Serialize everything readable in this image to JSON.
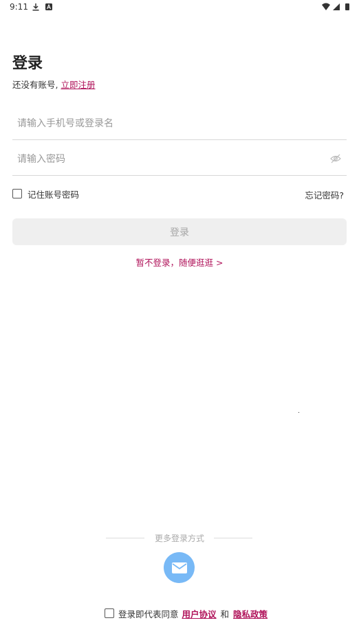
{
  "status_bar": {
    "time": "9:11",
    "download_icon": "download-icon",
    "app_icon": "a-box-icon",
    "signal_icons": [
      "wifi-icon",
      "cell-signal-icon",
      "battery-icon"
    ]
  },
  "header": {
    "title": "登录",
    "no_account_text": "还没有账号,",
    "register_link": "立即注册"
  },
  "form": {
    "username_placeholder": "请输入手机号或登录名",
    "username_value": "",
    "password_placeholder": "请输入密码",
    "password_value": "",
    "remember_label": "记住账号密码",
    "remember_checked": false,
    "forgot_link": "忘记密码?",
    "login_button": "登录",
    "guest_link": "暂不登录，随便逛逛 >"
  },
  "more": {
    "label": "更多登录方式",
    "method_icon": "mail-icon"
  },
  "agreement": {
    "checked": false,
    "prefix": "登录即代表同意",
    "user_agreement": "用户协议",
    "and": "和",
    "privacy_policy": "隐私政策"
  },
  "colors": {
    "accent": "#b0135a",
    "mail_button": "#78b9f6",
    "disabled_button_bg": "#efefef"
  }
}
